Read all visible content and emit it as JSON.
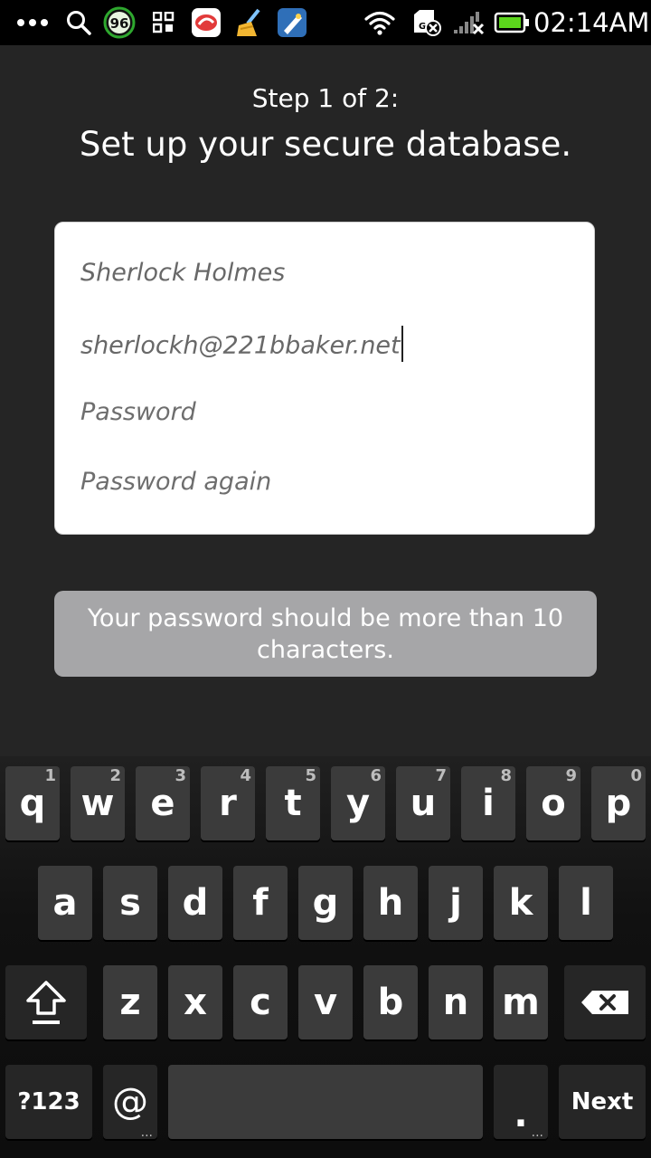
{
  "status_bar": {
    "time": "02:14AM",
    "badge_value": "96",
    "icons": [
      "overflow-dots-icon",
      "search-icon",
      "battery-saver-icon",
      "apps-grid-icon",
      "app-icon-red",
      "cleaner-broom-icon",
      "app-icon-blue",
      "wifi-icon",
      "sd-card-error-icon",
      "signal-no-service-icon",
      "battery-icon"
    ],
    "battery_color": "#5cd61c"
  },
  "app": {
    "step": "Step 1 of 2:",
    "title": "Set up your secure database.",
    "form": {
      "name_value": "Sherlock Holmes",
      "email_value": "sherlockh@221bbaker.net",
      "password_placeholder": "Password",
      "password_again_placeholder": "Password again"
    },
    "hint": "Your password should be more than 10 characters."
  },
  "keyboard": {
    "row1": [
      {
        "label": "q",
        "num": "1"
      },
      {
        "label": "w",
        "num": "2"
      },
      {
        "label": "e",
        "num": "3"
      },
      {
        "label": "r",
        "num": "4"
      },
      {
        "label": "t",
        "num": "5"
      },
      {
        "label": "y",
        "num": "6"
      },
      {
        "label": "u",
        "num": "7"
      },
      {
        "label": "i",
        "num": "8"
      },
      {
        "label": "o",
        "num": "9"
      },
      {
        "label": "p",
        "num": "0"
      }
    ],
    "row2": [
      "a",
      "s",
      "d",
      "f",
      "g",
      "h",
      "j",
      "k",
      "l"
    ],
    "row3": [
      "z",
      "x",
      "c",
      "v",
      "b",
      "n",
      "m"
    ],
    "symbols_label": "?123",
    "at_label": "@",
    "period_label": ".",
    "next_label": "Next",
    "long_press_indicator": "..."
  }
}
